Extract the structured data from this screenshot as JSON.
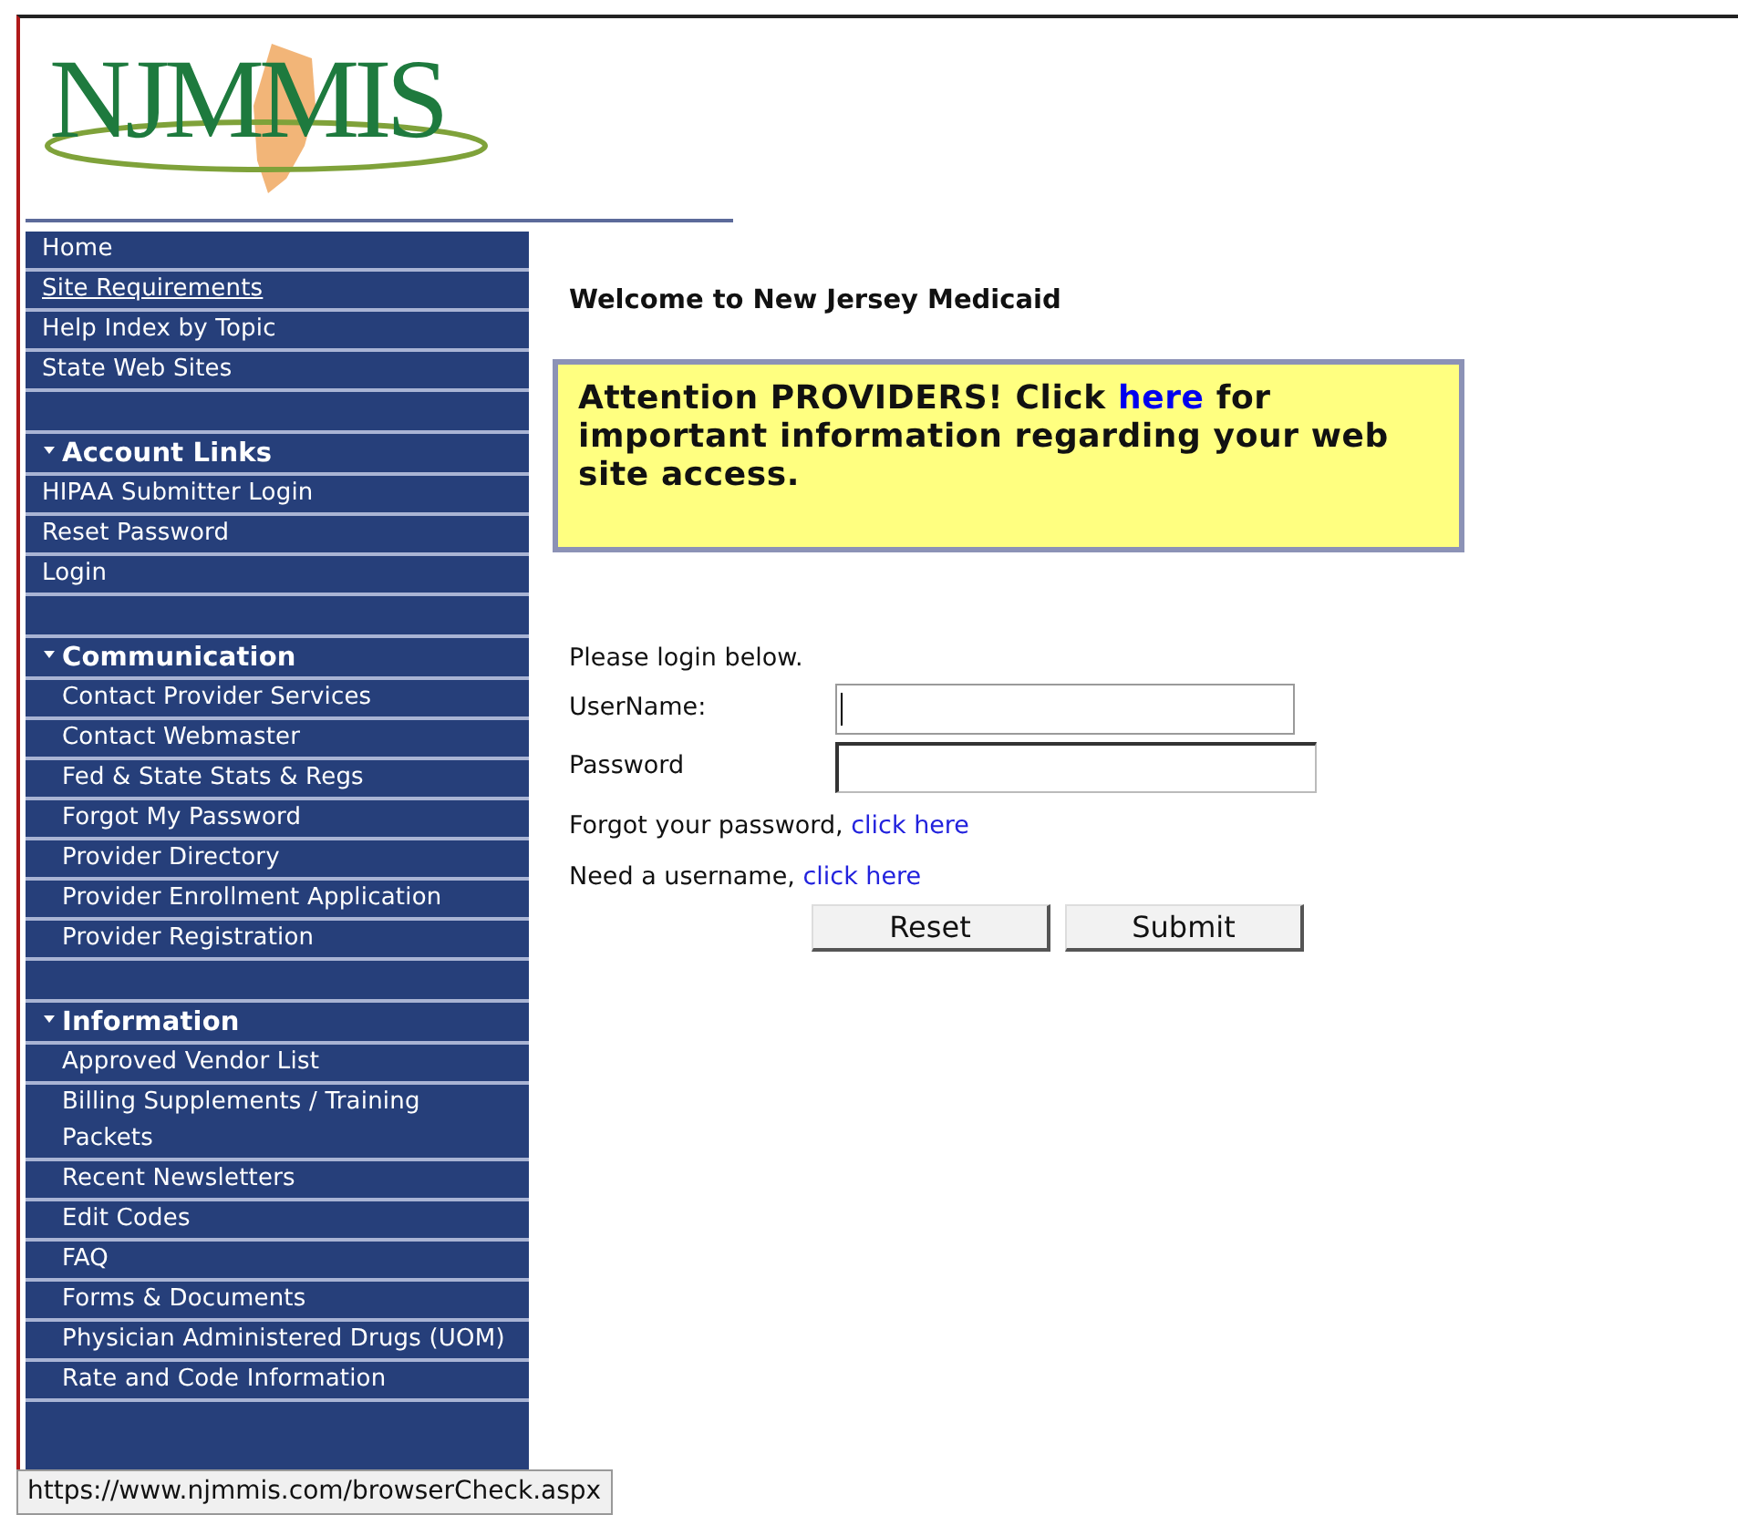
{
  "logo": {
    "text": "NJMMIS"
  },
  "sidebar": {
    "links": [
      {
        "label": "Home",
        "hovered": false
      },
      {
        "label": "Site Requirements",
        "hovered": true
      },
      {
        "label": "Help Index by Topic",
        "hovered": false
      },
      {
        "label": "State Web Sites",
        "hovered": false
      }
    ],
    "sections": [
      {
        "title": "Account Links",
        "indented": false,
        "items": [
          "HIPAA Submitter Login",
          "Reset Password",
          "Login"
        ]
      },
      {
        "title": "Communication",
        "indented": true,
        "items": [
          "Contact Provider Services",
          "Contact Webmaster",
          "Fed & State Stats & Regs",
          "Forgot My Password",
          "Provider Directory",
          "Provider Enrollment Application",
          "Provider Registration"
        ]
      },
      {
        "title": "Information",
        "indented": true,
        "items": [
          "Approved Vendor List",
          "Billing Supplements / Training Packets",
          "Recent Newsletters",
          "Edit Codes",
          "FAQ",
          "Forms & Documents",
          "Physician Administered Drugs (UOM)",
          "Rate and Code Information"
        ]
      }
    ]
  },
  "main": {
    "heading": "Welcome to New Jersey Medicaid",
    "notice": {
      "before": "Attention PROVIDERS! Click ",
      "link": "here",
      "after": " for important information regarding your web site access."
    },
    "login": {
      "prompt": "Please login below.",
      "fields": [
        {
          "label": "UserName:",
          "focused": true
        },
        {
          "label": "Password",
          "focused": false
        }
      ],
      "help": [
        {
          "text": "Forgot your password,",
          "link": "click here"
        },
        {
          "text": "Need a username,",
          "link": "click here"
        }
      ],
      "buttons": [
        "Reset",
        "Submit"
      ]
    }
  },
  "status_bar": {
    "url": "https://www.njmmis.com/browserCheck.aspx"
  }
}
